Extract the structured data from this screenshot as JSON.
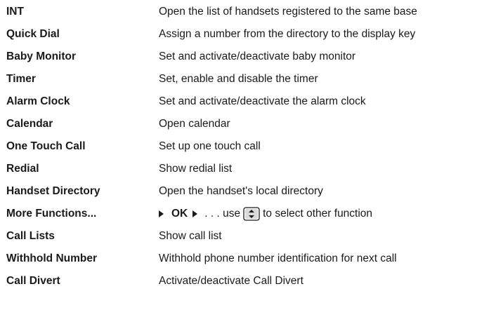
{
  "rows": [
    {
      "term": "INT",
      "desc": "Open the list of handsets registered to the same base"
    },
    {
      "term": "Quick Dial",
      "desc": "Assign a number from the directory to the display key"
    },
    {
      "term": "Baby Monitor",
      "desc": "Set and activate/deactivate baby monitor"
    },
    {
      "term": "Timer",
      "desc": "Set, enable and disable the timer"
    },
    {
      "term": "Alarm Clock",
      "desc": "Set and activate/deactivate the alarm clock"
    },
    {
      "term": "Calendar",
      "desc": "Open calendar"
    },
    {
      "term": "One Touch Call",
      "desc": "Set up one touch call"
    },
    {
      "term": "Redial",
      "desc": "Show redial list"
    },
    {
      "term": "Handset Directory",
      "desc": "Open the handset's local directory"
    },
    {
      "term": "More Functions...",
      "desc_parts": {
        "ok": "OK",
        "before_icon": ". . . use",
        "after_icon": "to select other function"
      },
      "icons": [
        "arrow-right-icon",
        "navigation-key-icon"
      ]
    },
    {
      "term": "Call Lists",
      "desc": "Show call list"
    },
    {
      "term": "Withhold Number",
      "desc": "Withhold phone number identification for next call"
    },
    {
      "term": "Call Divert",
      "desc": "Activate/deactivate Call Divert"
    }
  ]
}
